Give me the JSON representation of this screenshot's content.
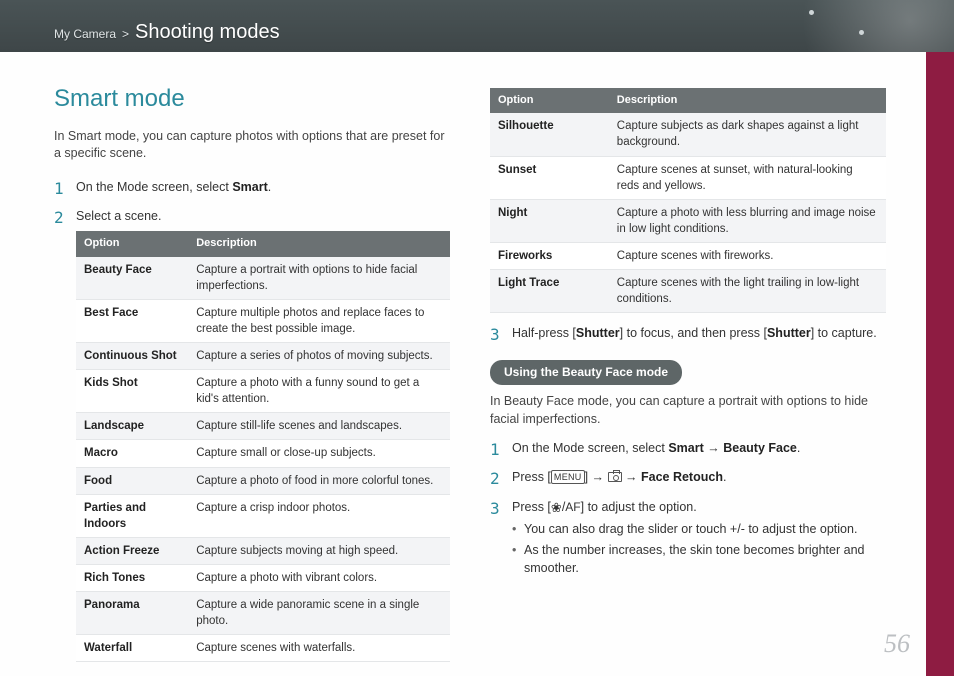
{
  "breadcrumb": {
    "root": "My Camera",
    "sep": ">",
    "current": "Shooting modes"
  },
  "page_number": "56",
  "section_title": "Smart mode",
  "lead": "In Smart mode, you can capture photos with options that are preset for a specific scene.",
  "step1": {
    "pre": "On the Mode screen, select ",
    "bold": "Smart",
    "post": "."
  },
  "step2": "Select a scene.",
  "table_headers": {
    "option": "Option",
    "description": "Description"
  },
  "table1": [
    {
      "option": "Beauty Face",
      "desc": "Capture a portrait with options to hide facial imperfections."
    },
    {
      "option": "Best Face",
      "desc": "Capture multiple photos and replace faces to create the best possible image."
    },
    {
      "option": "Continuous Shot",
      "desc": "Capture a series of photos of moving subjects."
    },
    {
      "option": "Kids Shot",
      "desc": "Capture a photo with a funny sound to get a kid's attention."
    },
    {
      "option": "Landscape",
      "desc": "Capture still-life scenes and landscapes."
    },
    {
      "option": "Macro",
      "desc": "Capture small or close-up subjects."
    },
    {
      "option": "Food",
      "desc": "Capture a photo of food in more colorful tones."
    },
    {
      "option": "Parties and Indoors",
      "desc": "Capture a crisp indoor photos."
    },
    {
      "option": "Action Freeze",
      "desc": "Capture subjects moving at high speed."
    },
    {
      "option": "Rich Tones",
      "desc": "Capture a photo with vibrant colors."
    },
    {
      "option": "Panorama",
      "desc": "Capture a wide panoramic scene in a single photo."
    },
    {
      "option": "Waterfall",
      "desc": "Capture scenes with waterfalls."
    }
  ],
  "table2": [
    {
      "option": "Silhouette",
      "desc": "Capture subjects as dark shapes against a light background."
    },
    {
      "option": "Sunset",
      "desc": "Capture scenes at sunset, with natural-looking reds and yellows."
    },
    {
      "option": "Night",
      "desc": "Capture a photo with less blurring and image noise in low light conditions."
    },
    {
      "option": "Fireworks",
      "desc": "Capture scenes with fireworks."
    },
    {
      "option": "Light Trace",
      "desc": "Capture scenes with the light trailing in low-light conditions."
    }
  ],
  "step3": {
    "a": "Half-press [",
    "b1": "Shutter",
    "c": "] to focus, and then press [",
    "b2": "Shutter",
    "d": "] to capture."
  },
  "sub_heading": "Using the Beauty Face mode",
  "sub_lead": "In Beauty Face mode, you can capture a portrait with options to hide facial imperfections.",
  "bstep1": {
    "pre": "On the Mode screen, select ",
    "b1": "Smart",
    "arrow": " → ",
    "b2": "Beauty Face",
    "post": "."
  },
  "bstep2": {
    "pre": "Press [",
    "menu": "MENU",
    "mid": "] → ",
    "arrow2": " → ",
    "bold": "Face Retouch",
    "post": "."
  },
  "bstep3": {
    "pre": "Press [",
    "slash": "/",
    "af": "AF",
    "post": "] to adjust the option."
  },
  "bullets": [
    "You can also drag the slider or touch +/- to adjust the option.",
    "As the number increases, the skin tone becomes brighter and smoother."
  ]
}
